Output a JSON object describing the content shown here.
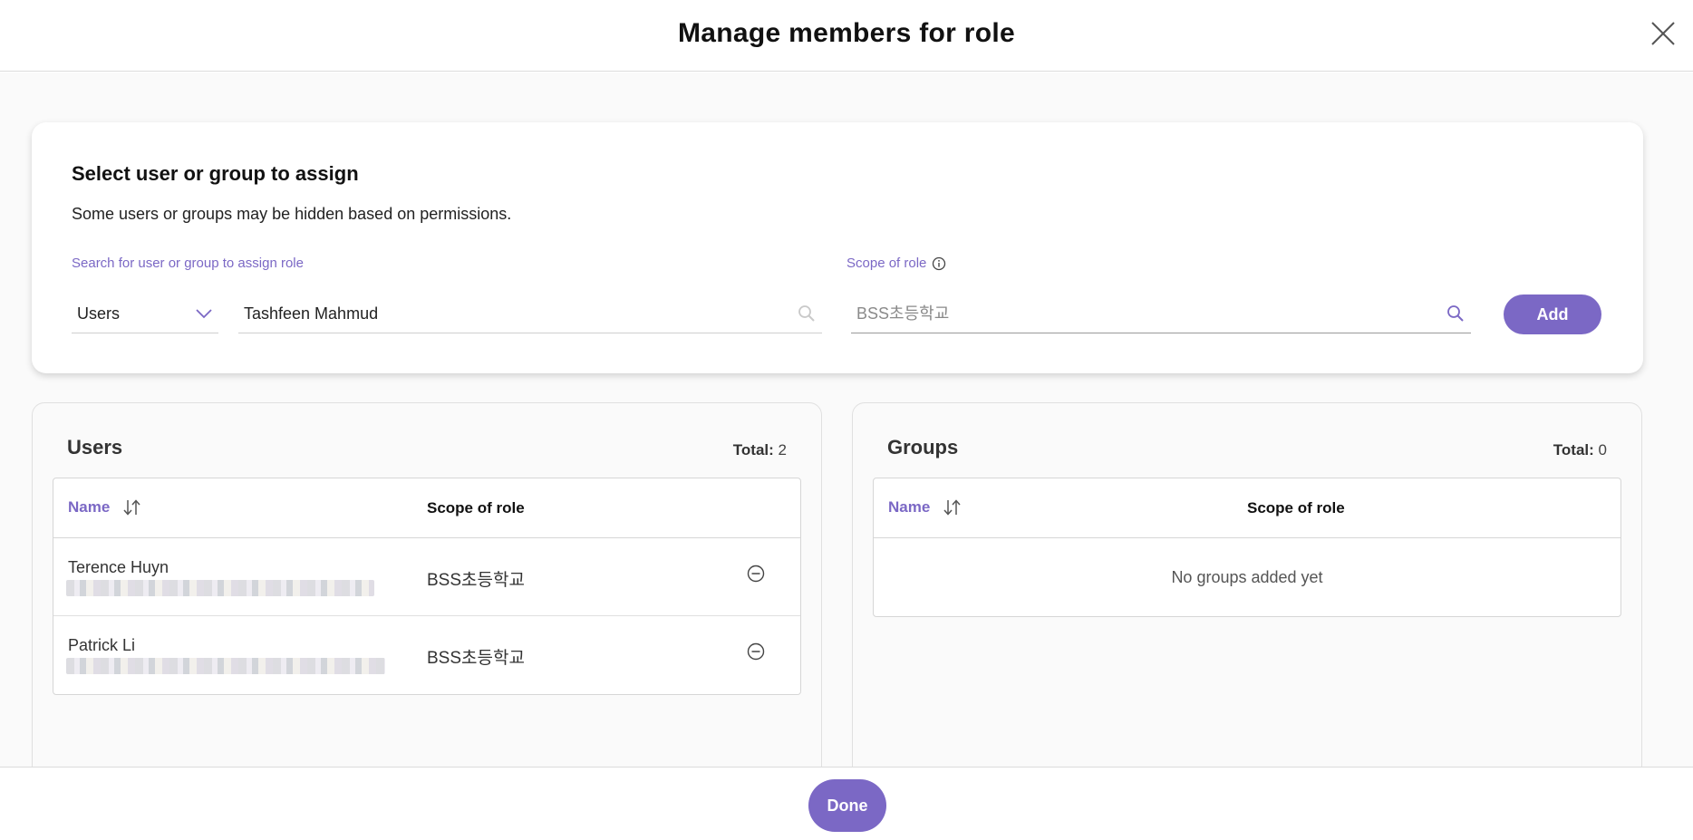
{
  "dialog": {
    "title": "Manage members for role"
  },
  "assign": {
    "title": "Select user or group to assign",
    "subtitle": "Some users or groups may be hidden based on permissions.",
    "search_label": "Search for user or group to assign role",
    "scope_label": "Scope of role",
    "type_select_value": "Users",
    "search_value": "Tashfeen Mahmud",
    "scope_placeholder": "BSS초등학교",
    "add_label": "Add"
  },
  "users_panel": {
    "title": "Users",
    "total_label": "Total:",
    "total_value": "2",
    "col_name": "Name",
    "col_scope": "Scope of role",
    "rows": [
      {
        "name": "Terence Huyn",
        "scope": "BSS초등학교"
      },
      {
        "name": "Patrick Li",
        "scope": "BSS초등학교"
      }
    ]
  },
  "groups_panel": {
    "title": "Groups",
    "total_label": "Total:",
    "total_value": "0",
    "col_name": "Name",
    "col_scope": "Scope of role",
    "empty_text": "No groups added yet"
  },
  "footer": {
    "done_label": "Done"
  },
  "colors": {
    "accent": "#7b68c5",
    "background": "#fafafa"
  },
  "icons": {
    "close": "close-icon",
    "chevron": "chevron-down-icon",
    "search": "search-icon",
    "info": "info-icon",
    "sort": "sort-icon",
    "remove": "remove-circle-icon"
  }
}
